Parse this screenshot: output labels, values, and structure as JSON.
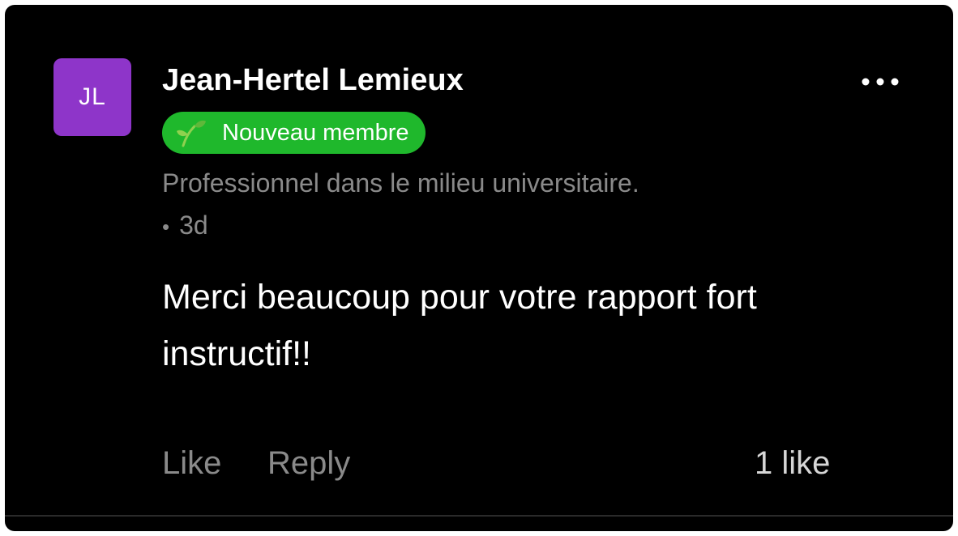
{
  "comment": {
    "author": {
      "initials": "JL",
      "name": "Jean-Hertel Lemieux",
      "avatar_color": "#8e35c9",
      "badge": {
        "label": "Nouveau membre",
        "icon": "sprout-icon",
        "color": "#1fb82c"
      },
      "headline": "Professionnel dans le milieu universitaire.",
      "timestamp": "3d",
      "separator": "•"
    },
    "text": "Merci beaucoup pour votre rapport fort instructif!!",
    "more_icon": "more-horizontal-icon"
  },
  "actions": {
    "like_label": "Like",
    "reply_label": "Reply",
    "like_count": "1 like"
  },
  "colors": {
    "background": "#000000",
    "primary_text": "#ffffff",
    "secondary_text": "#8a8a8a"
  }
}
